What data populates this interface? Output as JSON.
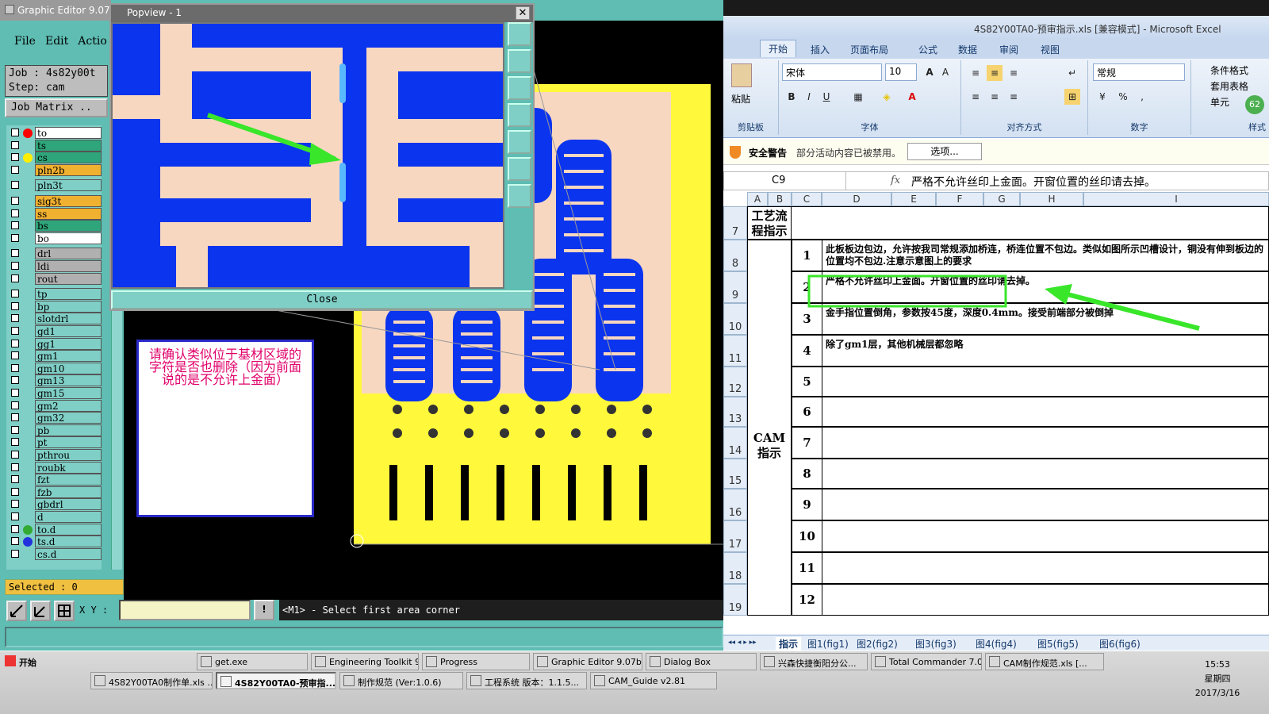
{
  "graphic_editor": {
    "title": "Graphic Editor 9.07",
    "menu": [
      "File",
      "Edit",
      "Actio"
    ],
    "job_line": "Job : 4s82y00t",
    "step_line": "Step: cam",
    "job_matrix_label": "Job Matrix ..",
    "layers": [
      {
        "name": "to",
        "color": "#ffffff",
        "dot": "#ff0000"
      },
      {
        "name": "ts",
        "color": "#2ea57a",
        "dot": ""
      },
      {
        "name": "cs",
        "color": "#2ea57a",
        "dot": "#ffee00"
      },
      {
        "name": "pln2b",
        "color": "#f0b030",
        "dot": ""
      },
      {
        "name": "pln3t",
        "color": "#7fcfc6",
        "dot": ""
      },
      {
        "name": "sig3t",
        "color": "#f0b030",
        "dot": ""
      },
      {
        "name": "ss",
        "color": "#f0b030",
        "dot": ""
      },
      {
        "name": "bs",
        "color": "#2ea57a",
        "dot": ""
      },
      {
        "name": "bo",
        "color": "#ffffff",
        "dot": ""
      },
      {
        "name": "drl",
        "color": "#b0b0b0",
        "dot": ""
      },
      {
        "name": "ldi",
        "color": "#b0b0b0",
        "dot": ""
      },
      {
        "name": "rout",
        "color": "#b0b0b0",
        "dot": ""
      },
      {
        "name": "tp",
        "color": "#7fcfc6",
        "dot": ""
      },
      {
        "name": "bp",
        "color": "#7fcfc6",
        "dot": ""
      },
      {
        "name": "slotdrl",
        "color": "#7fcfc6",
        "dot": ""
      },
      {
        "name": "gd1",
        "color": "#7fcfc6",
        "dot": ""
      },
      {
        "name": "gg1",
        "color": "#7fcfc6",
        "dot": ""
      },
      {
        "name": "gm1",
        "color": "#7fcfc6",
        "dot": ""
      },
      {
        "name": "gm10",
        "color": "#7fcfc6",
        "dot": ""
      },
      {
        "name": "gm13",
        "color": "#7fcfc6",
        "dot": ""
      },
      {
        "name": "gm15",
        "color": "#7fcfc6",
        "dot": ""
      },
      {
        "name": "gm2",
        "color": "#7fcfc6",
        "dot": ""
      },
      {
        "name": "gm32",
        "color": "#7fcfc6",
        "dot": ""
      },
      {
        "name": "pb",
        "color": "#7fcfc6",
        "dot": ""
      },
      {
        "name": "pt",
        "color": "#7fcfc6",
        "dot": ""
      },
      {
        "name": "pthrou",
        "color": "#7fcfc6",
        "dot": ""
      },
      {
        "name": "roubk",
        "color": "#7fcfc6",
        "dot": ""
      },
      {
        "name": "fzt",
        "color": "#7fcfc6",
        "dot": ""
      },
      {
        "name": "fzb",
        "color": "#7fcfc6",
        "dot": ""
      },
      {
        "name": "gbdrl",
        "color": "#7fcfc6",
        "dot": ""
      },
      {
        "name": "d",
        "color": "#7fcfc6",
        "dot": ""
      },
      {
        "name": "to.d",
        "color": "#7fcfc6",
        "dot": "#33aa33"
      },
      {
        "name": "ts.d",
        "color": "#7fcfc6",
        "dot": "#2233dd"
      },
      {
        "name": "cs.d",
        "color": "#7fcfc6",
        "dot": ""
      }
    ],
    "selected_label": "Selected : 0",
    "xy_label": "X Y :",
    "xy_value": "",
    "status_message": "<M1> - Select first area corner",
    "note_text": "请确认类似位于基材区域的字符是否也删除（因为前面说的是不允许上金面）"
  },
  "popview": {
    "title": "Popview - 1",
    "close_x": "✕",
    "close_button": "Close"
  },
  "excel": {
    "window_title": "4S82Y00TA0-预审指示.xls  [兼容模式] - Microsoft Excel",
    "tabs": [
      "开始",
      "插入",
      "页面布局",
      "公式",
      "数据",
      "审阅",
      "视图"
    ],
    "groups": [
      "剪贴板",
      "字体",
      "对齐方式",
      "数字",
      "样式"
    ],
    "paste_label": "粘贴",
    "font_name": "宋体",
    "font_size": "10",
    "number_format": "常规",
    "style_items": [
      "条件格式",
      "套用表格",
      "单元"
    ],
    "security_title": "安全警告",
    "security_text": "部分活动内容已被禁用。",
    "security_button": "选项...",
    "name_box": "C9",
    "fx_label": "fx",
    "formula_value": "严格不允许丝印上金面。开窗位置的丝印请去掉。",
    "columns": [
      "A",
      "B",
      "C",
      "D",
      "E",
      "F",
      "G",
      "H",
      "I"
    ],
    "row_numbers": [
      "7",
      "8",
      "9",
      "10",
      "11",
      "12",
      "13",
      "14",
      "15",
      "16",
      "17",
      "18",
      "19"
    ],
    "header_a": "工艺流程指示",
    "section_label": "CAM指示",
    "instructions": [
      {
        "num": "1",
        "text": "此板板边包边，允许按我司常规添加桥连，桥连位置不包边。类似如图所示凹槽设计，铜没有伸到板边的位置均不包边.注意示意图上的要求"
      },
      {
        "num": "2",
        "text": "严格不允许丝印上金面。开窗位置的丝印请去掉。"
      },
      {
        "num": "3",
        "text": "金手指位置倒角，参数按45度，深度0.4mm。接受前端部分被倒掉"
      },
      {
        "num": "4",
        "text": "除了gm1层，其他机械层都忽略"
      },
      {
        "num": "5",
        "text": ""
      },
      {
        "num": "6",
        "text": ""
      },
      {
        "num": "7",
        "text": ""
      },
      {
        "num": "8",
        "text": ""
      },
      {
        "num": "9",
        "text": ""
      },
      {
        "num": "10",
        "text": ""
      },
      {
        "num": "11",
        "text": ""
      },
      {
        "num": "12",
        "text": ""
      }
    ],
    "sheet_tabs": [
      "指示",
      "图1(fig1)",
      "图2(fig2)",
      "图3(fig3)",
      "图4(fig4)",
      "图5(fig5)",
      "图6(fig6)"
    ],
    "bubble_value": "62"
  },
  "taskbar": {
    "start_label": "开始",
    "row1": [
      "get.exe",
      "Engineering Toolkit 9....",
      "Progress",
      "Graphic Editor 9.07b2...",
      "Dialog Box",
      "兴森快捷衡阳分公...",
      "Total Commander 7.0...",
      "CAM制作规范.xls [..."
    ],
    "row2": [
      "4S82Y00TA0制作单.xls ...",
      "4S82Y00TA0-预审指...",
      "制作规范 (Ver:1.0.6)",
      "工程系统  版本：1.1.5...",
      "CAM_Guide v2.81"
    ],
    "active_item": "4S82Y00TA0-预审指...",
    "time": "15:53",
    "weekday": "星期四",
    "date": "2017/3/16"
  },
  "colors": {
    "teal_bg": "#5fbdb3",
    "board_yellow": "#fff83b",
    "trace_blue": "#0b34ee",
    "copper": "#f8d7c0",
    "highlight_green": "#39e62a",
    "note_text": "#e0006a"
  }
}
